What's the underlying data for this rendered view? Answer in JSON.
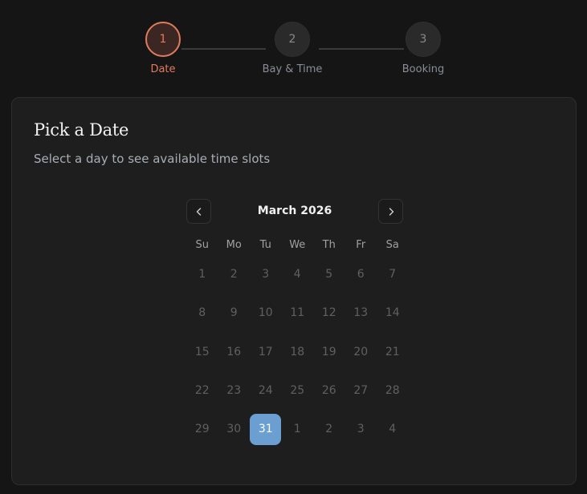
{
  "stepper": {
    "steps": [
      {
        "number": "1",
        "label": "Date",
        "active": true
      },
      {
        "number": "2",
        "label": "Bay & Time",
        "active": false
      },
      {
        "number": "3",
        "label": "Booking",
        "active": false
      }
    ]
  },
  "card": {
    "title": "Pick a Date",
    "subtitle": "Select a day to see available time slots"
  },
  "calendar": {
    "month_label": "March 2026",
    "weekdays": [
      "Su",
      "Mo",
      "Tu",
      "We",
      "Th",
      "Fr",
      "Sa"
    ],
    "days": [
      {
        "label": "1",
        "state": "disabled"
      },
      {
        "label": "2",
        "state": "disabled"
      },
      {
        "label": "3",
        "state": "disabled"
      },
      {
        "label": "4",
        "state": "disabled"
      },
      {
        "label": "5",
        "state": "disabled"
      },
      {
        "label": "6",
        "state": "disabled"
      },
      {
        "label": "7",
        "state": "disabled"
      },
      {
        "label": "8",
        "state": "disabled"
      },
      {
        "label": "9",
        "state": "disabled"
      },
      {
        "label": "10",
        "state": "disabled"
      },
      {
        "label": "11",
        "state": "disabled"
      },
      {
        "label": "12",
        "state": "disabled"
      },
      {
        "label": "13",
        "state": "disabled"
      },
      {
        "label": "14",
        "state": "disabled"
      },
      {
        "label": "15",
        "state": "disabled"
      },
      {
        "label": "16",
        "state": "disabled"
      },
      {
        "label": "17",
        "state": "disabled"
      },
      {
        "label": "18",
        "state": "disabled"
      },
      {
        "label": "19",
        "state": "disabled"
      },
      {
        "label": "20",
        "state": "disabled"
      },
      {
        "label": "21",
        "state": "disabled"
      },
      {
        "label": "22",
        "state": "disabled"
      },
      {
        "label": "23",
        "state": "disabled"
      },
      {
        "label": "24",
        "state": "disabled"
      },
      {
        "label": "25",
        "state": "disabled"
      },
      {
        "label": "26",
        "state": "disabled"
      },
      {
        "label": "27",
        "state": "disabled"
      },
      {
        "label": "28",
        "state": "disabled"
      },
      {
        "label": "29",
        "state": "disabled"
      },
      {
        "label": "30",
        "state": "disabled"
      },
      {
        "label": "31",
        "state": "selected"
      },
      {
        "label": "1",
        "state": "outside"
      },
      {
        "label": "2",
        "state": "outside"
      },
      {
        "label": "3",
        "state": "outside"
      },
      {
        "label": "4",
        "state": "outside"
      }
    ],
    "prev_icon": "chevron-left-icon",
    "next_icon": "chevron-right-icon"
  },
  "colors": {
    "accent": "#e07c5e",
    "selected_day": "#6b9fd1",
    "background": "#151515",
    "card": "#1e1e1e"
  }
}
